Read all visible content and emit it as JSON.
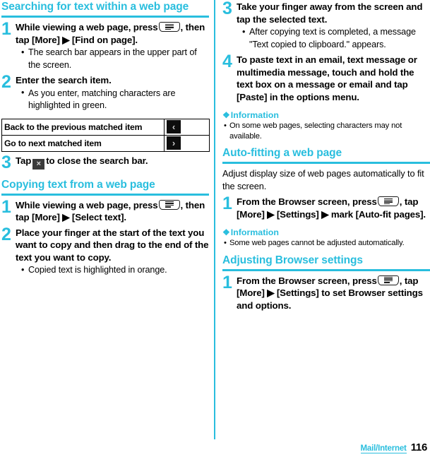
{
  "footer": {
    "section_tag": "Mail/Internet",
    "page_number": "116"
  },
  "colors": {
    "accent": "#29bede",
    "text": "#000000",
    "icon_dark": "#0d0d0d"
  },
  "icons": {
    "menu_key": "menu-key-icon",
    "close": "×",
    "prev": "‹",
    "next": "›",
    "triangle": "▶",
    "info_diamond": "❖"
  },
  "left_column": {
    "section1": {
      "heading": "Searching for text within a web page",
      "steps": [
        {
          "num": "1",
          "title_pre": "While viewing a web page, press",
          "title_post": ", then tap [More] ▶ [Find on page].",
          "bullets": [
            "The search bar appears in the upper part of the screen."
          ]
        },
        {
          "num": "2",
          "title": "Enter the search item.",
          "bullets": [
            "As you enter, matching characters are highlighted in green."
          ]
        },
        {
          "num": "3",
          "title_pre": "Tap",
          "title_post": "to close the search bar.",
          "bullets": []
        }
      ],
      "table": {
        "rows": [
          {
            "label": "Back to the previous matched item",
            "icon": "‹",
            "icon_name": "prev-match-icon"
          },
          {
            "label": "Go to next matched item",
            "icon": "›",
            "icon_name": "next-match-icon"
          }
        ]
      }
    },
    "section2": {
      "heading": "Copying text from a web page",
      "steps": [
        {
          "num": "1",
          "title_pre": "While viewing a web page, press",
          "title_post": ", then tap [More] ▶ [Select text].",
          "bullets": []
        },
        {
          "num": "2",
          "title": "Place your finger at the start of the text you want to copy and then drag to the end of the text you want to copy.",
          "bullets": [
            "Copied text is highlighted in orange."
          ]
        }
      ]
    }
  },
  "right_column": {
    "continued_steps": [
      {
        "num": "3",
        "title": "Take your finger away from the screen and tap the selected text.",
        "bullets": [
          "After copying text is completed, a message \"Text copied to clipboard.\" appears."
        ]
      },
      {
        "num": "4",
        "title": "To paste text in an email, text message or multimedia message, touch and hold the text box on a message or email and tap [Paste] in the options menu.",
        "bullets": []
      }
    ],
    "info1": {
      "heading": "Information",
      "items": [
        "On some web pages, selecting characters may not available."
      ]
    },
    "section3": {
      "heading": "Auto-fitting a web page",
      "intro": "Adjust display size of web pages automatically to fit the screen.",
      "steps": [
        {
          "num": "1",
          "title_pre": "From the Browser screen, press",
          "title_post": ", tap [More] ▶ [Settings] ▶ mark [Auto-fit pages].",
          "bullets": []
        }
      ]
    },
    "info2": {
      "heading": "Information",
      "items": [
        "Some web pages cannot be adjusted automatically."
      ]
    },
    "section4": {
      "heading": "Adjusting Browser settings",
      "steps": [
        {
          "num": "1",
          "title_pre": "From the Browser screen, press",
          "title_post": ", tap [More] ▶ [Settings] to set Browser settings and options.",
          "bullets": []
        }
      ]
    }
  }
}
